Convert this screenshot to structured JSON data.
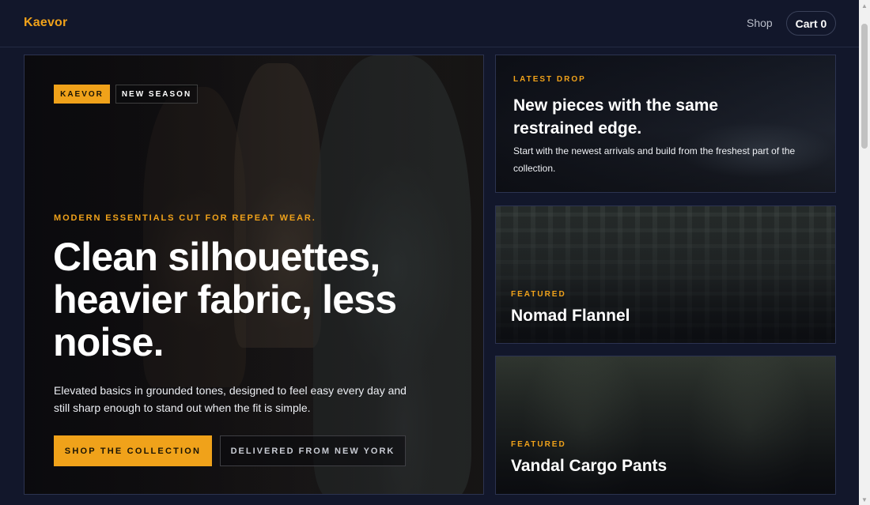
{
  "header": {
    "brand": "Kaevor",
    "nav_shop": "Shop",
    "cart_label": "Cart 0"
  },
  "hero": {
    "badge_brand": "KAEVOR",
    "badge_season": "NEW SEASON",
    "kicker": "MODERN ESSENTIALS CUT FOR REPEAT WEAR.",
    "title": "Clean silhouettes, heavier fabric, less noise.",
    "copy": "Elevated basics in grounded tones, designed to feel easy every day and still sharp enough to stand out when the fit is simple.",
    "primary_cta": "SHOP THE COLLECTION",
    "secondary_cta": "DELIVERED FROM NEW YORK"
  },
  "cards": {
    "latest": {
      "kicker": "LATEST DROP",
      "title": "New pieces with the same restrained edge.",
      "copy": "Start with the newest arrivals and build from the freshest part of the collection."
    },
    "flannel": {
      "kicker": "FEATURED",
      "title": "Nomad Flannel"
    },
    "cargo": {
      "kicker": "FEATURED",
      "title": "Vandal Cargo Pants"
    }
  },
  "colors": {
    "background": "#12172b",
    "accent": "#f0a21a",
    "border": "#2c3350"
  },
  "icons": {
    "scroll_up": "triangle-up-icon",
    "scroll_down": "triangle-down-icon"
  }
}
